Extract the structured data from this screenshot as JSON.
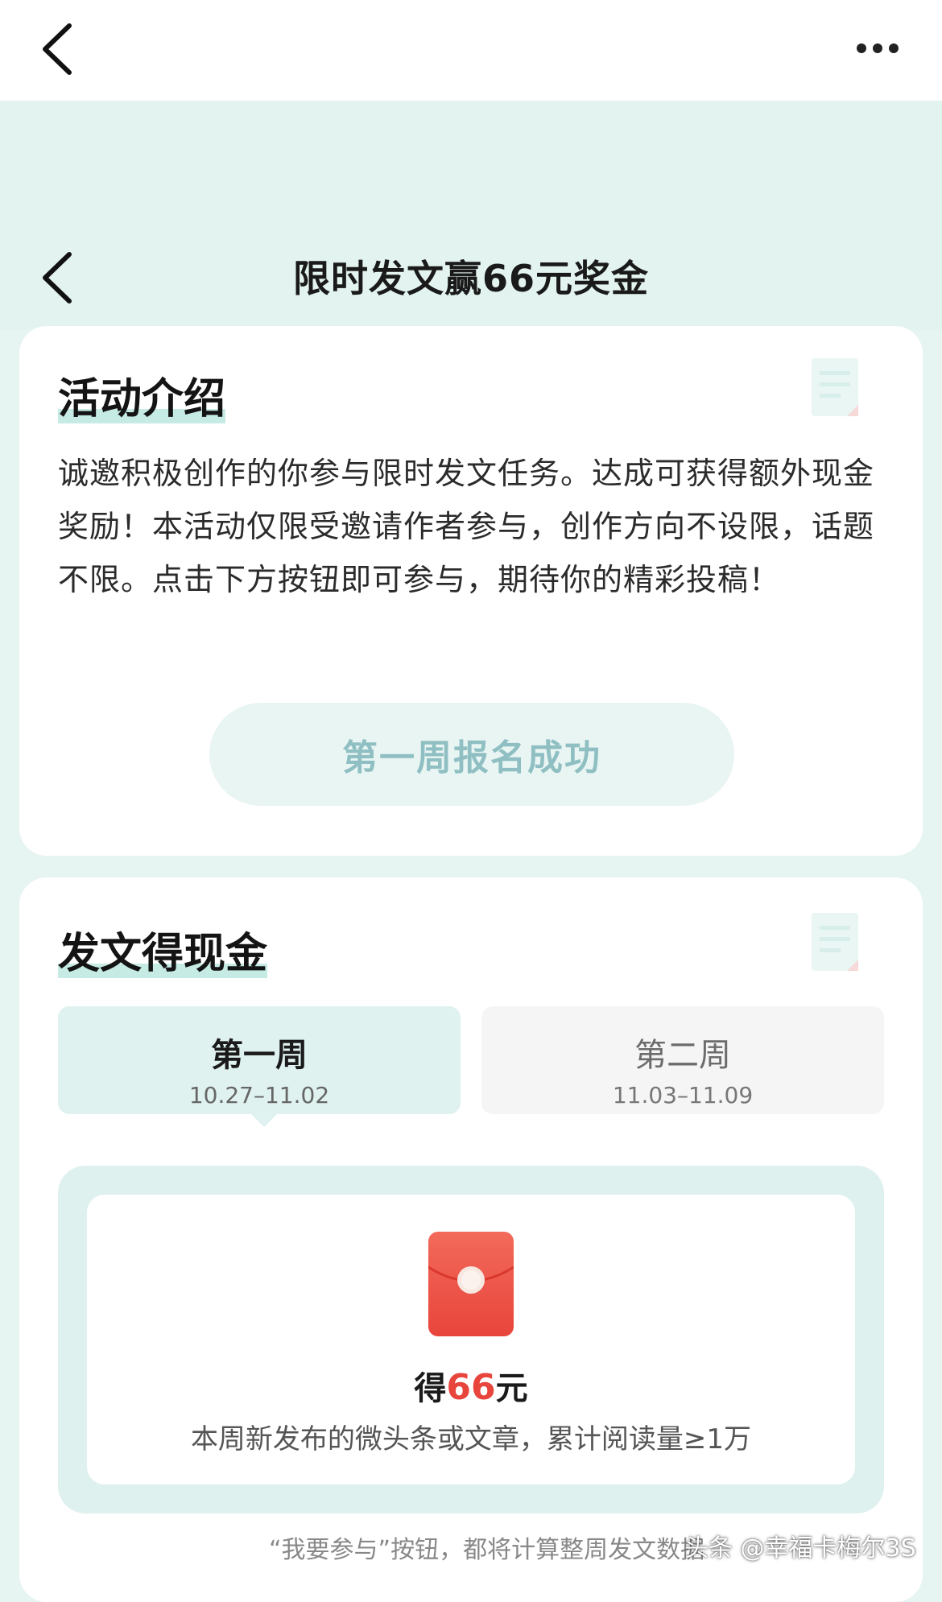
{
  "nav": {
    "back_icon": "chevron-left-icon",
    "more_icon": "more-horizontal-icon"
  },
  "header": {
    "title": "限时发文赢66元奖金"
  },
  "intro": {
    "title": "活动介绍",
    "text": "诚邀积极创作的你参与限时发文任务。达成可获得额外现金奖励！本活动仅限受邀请作者参与，创作方向不设限，话题不限。点击下方按钮即可参与，期待你的精彩投稿！",
    "signup_label": "第一周报名成功"
  },
  "cash": {
    "title": "发文得现金",
    "tabs": [
      {
        "name": "第一周",
        "dates": "10.27–11.02",
        "active": true
      },
      {
        "name": "第二周",
        "dates": "11.03–11.09",
        "active": false
      }
    ],
    "reward_prefix": "得",
    "reward_amount": "66",
    "reward_suffix": "元",
    "reward_condition": "本周新发布的微头条或文章，累计阅读量≥1万",
    "footnote": "“我要参与”按钮，都将计算整周发文数据"
  },
  "watermark": "头条 @幸福卡梅尔3S",
  "colors": {
    "accent": "#e3f3f0",
    "reward_red": "#e8453c",
    "button_text": "#8fbfc2"
  }
}
